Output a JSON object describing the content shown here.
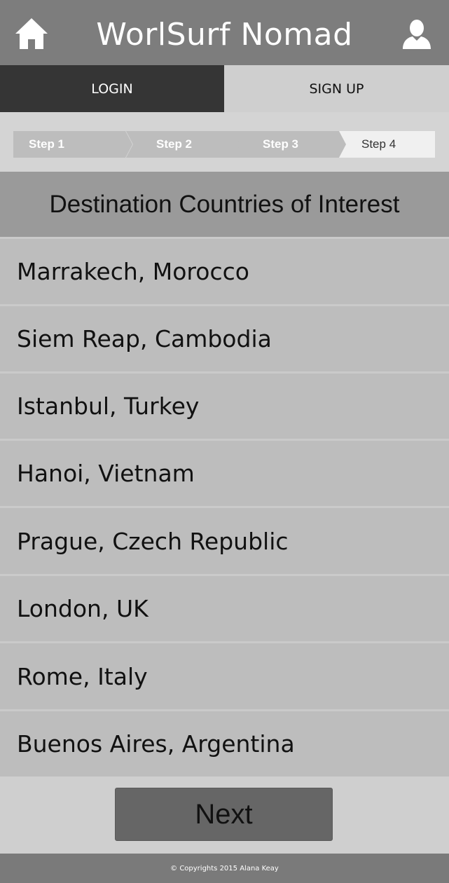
{
  "header": {
    "title": "WorlSurf Nomad",
    "left_icon": "home-icon",
    "right_icon": "user-icon"
  },
  "auth_tabs": {
    "login_label": "LOGIN",
    "signup_label": "SIGN UP",
    "active": "login"
  },
  "steps": {
    "items": [
      "Step 1",
      "Step 2",
      "Step 3",
      "Step 4"
    ],
    "current": "Step 4"
  },
  "section": {
    "heading": "Destination Countries of Interest"
  },
  "destinations": [
    "Marrakech, Morocco",
    "Siem Reap, Cambodia",
    "Istanbul, Turkey",
    "Hanoi, Vietnam",
    "Prague, Czech Republic",
    "London, UK",
    "Rome, Italy",
    "Buenos Aires, Argentina"
  ],
  "next_button": {
    "label": "Next"
  },
  "footer": {
    "copyright": "© Copyrights 2015 Alana Keay"
  },
  "colors": {
    "header_bg": "#7d7d7d",
    "tab_active_bg": "#353535",
    "list_item_bg": "#bdbdbd",
    "heading_bg": "#9a9a9a",
    "button_bg": "#666666"
  }
}
